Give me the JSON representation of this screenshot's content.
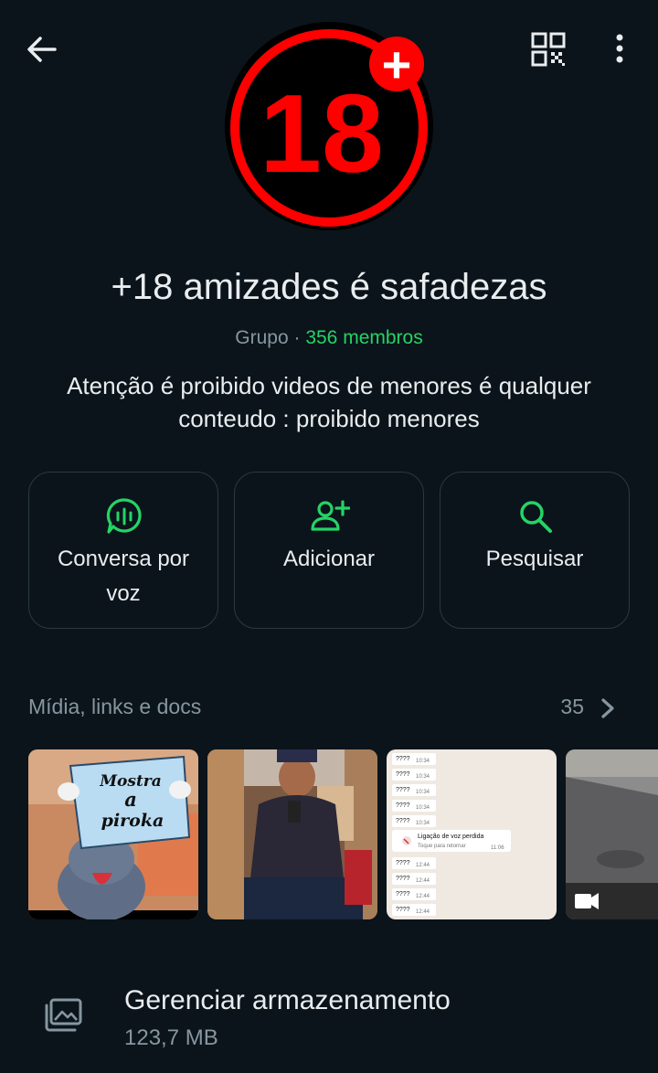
{
  "header": {
    "back_icon": "arrow-left-icon",
    "qr_icon": "qr-code-icon",
    "more_icon": "more-vertical-icon"
  },
  "avatar": {
    "badge_text": "18",
    "badge_plus": "+",
    "colors": {
      "ring": "#ff0000",
      "inner": "#000000",
      "text": "#ff0000"
    }
  },
  "group": {
    "name": "+18 amizades é safadezas",
    "type": "Grupo",
    "separator": " · ",
    "members": "356 membros",
    "description": "Atenção é proibido videos de menores é qualquer conteudo : proibido menores"
  },
  "actions": [
    {
      "label": "Conversa por voz",
      "icon": "voice-chat-icon"
    },
    {
      "label": "Adicionar",
      "icon": "add-person-icon"
    },
    {
      "label": "Pesquisar",
      "icon": "search-icon"
    }
  ],
  "media": {
    "title": "Mídia, links e docs",
    "count": "35",
    "items": [
      {
        "type": "image",
        "sign_line1": "Mostra",
        "sign_line2": "a",
        "sign_line3": "piroka"
      },
      {
        "type": "image"
      },
      {
        "type": "screenshot",
        "rows": [
          {
            "text": "????",
            "time": "10:34"
          },
          {
            "text": "????",
            "time": "10:34"
          },
          {
            "text": "????",
            "time": "10:34"
          },
          {
            "text": "????",
            "time": "10:34"
          },
          {
            "text": "????",
            "time": "10:34"
          }
        ],
        "call_title": "Ligação de voz perdida",
        "call_sub": "Toque para retornar",
        "call_time": "11:06",
        "rows2": [
          {
            "text": "????",
            "time": "12:44"
          },
          {
            "text": "????",
            "time": "12:44"
          },
          {
            "text": "????",
            "time": "12:44"
          },
          {
            "text": "????",
            "time": "12:44"
          }
        ]
      },
      {
        "type": "video",
        "icon": "video-camera-icon"
      }
    ]
  },
  "storage": {
    "title": "Gerenciar armazenamento",
    "size": "123,7 MB",
    "icon": "media-storage-icon"
  },
  "colors": {
    "background": "#0b141a",
    "accent": "#25d366",
    "text_primary": "#e9edef",
    "text_secondary": "#8696a0",
    "border": "#2a3942"
  }
}
